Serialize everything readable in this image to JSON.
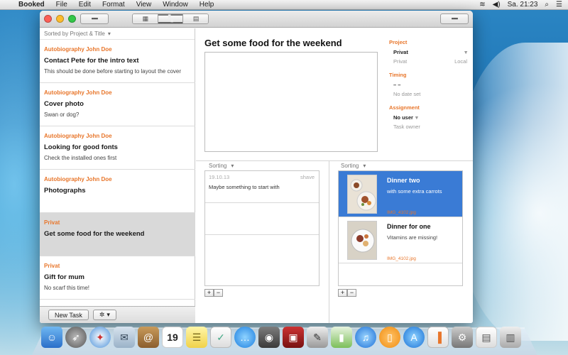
{
  "menubar": {
    "app_name": "Booked",
    "menus": [
      "File",
      "Edit",
      "Format",
      "View",
      "Window",
      "Help"
    ],
    "clock": "Sa. 21:23"
  },
  "sidebar": {
    "sort_label": "Sorted by Project & Title",
    "tasks": [
      {
        "project": "Autobiography John Doe",
        "title": "Contact Pete for the intro text",
        "note": "This should be done before starting to layout the cover"
      },
      {
        "project": "Autobiography John Doe",
        "title": "Cover photo",
        "note": "Swan or dog?"
      },
      {
        "project": "Autobiography John Doe",
        "title": "Looking for good fonts",
        "note": "Check the installed ones first"
      },
      {
        "project": "Autobiography John Doe",
        "title": "Photographs",
        "note": ""
      },
      {
        "project": "Privat",
        "title": "Get some food for the weekend",
        "note": ""
      },
      {
        "project": "Privat",
        "title": "Gift for mum",
        "note": "No scarf this time!"
      }
    ],
    "new_task_label": "New Task"
  },
  "detail": {
    "title": "Get some food for the weekend",
    "project_section": "Project",
    "project_value": "Privat",
    "project_sub_left": "Privat",
    "project_sub_right": "Local",
    "timing_section": "Timing",
    "timing_value": "– –",
    "timing_sub": "No date set",
    "assignment_section": "Assignment",
    "assignment_value": "No user",
    "assignment_sub": "Task owner"
  },
  "comments": {
    "sort_label": "Sorting",
    "items": [
      {
        "date": "19.10.13",
        "author": "shave",
        "text": "Maybe something to start with"
      }
    ]
  },
  "images": {
    "sort_label": "Sorting",
    "items": [
      {
        "name": "Dinner two",
        "desc": "with some extra carrots",
        "file": "IMG_4102.jpg",
        "selected": true
      },
      {
        "name": "Dinner for one",
        "desc": "Vitamins are missing!",
        "file": "IMG_4102.jpg",
        "selected": false
      }
    ]
  },
  "colors": {
    "accent_orange": "#e8762b",
    "selection_blue": "#3a7bd5",
    "sidebar_selected": "#d9d9d9"
  },
  "dock": {
    "icons": [
      "finder-icon",
      "launchpad-icon",
      "safari-icon",
      "mail-icon",
      "contacts-icon",
      "calendar-icon",
      "notes-icon",
      "reminders-icon",
      "messages-icon",
      "facetime-icon",
      "photo-booth-icon",
      "preview-icon",
      "numbers-icon",
      "itunes-icon",
      "ibooks-icon",
      "app-store-icon",
      "booked-icon",
      "system-preferences-icon",
      "document-icon",
      "trash-icon"
    ],
    "calendar_day": "19"
  }
}
